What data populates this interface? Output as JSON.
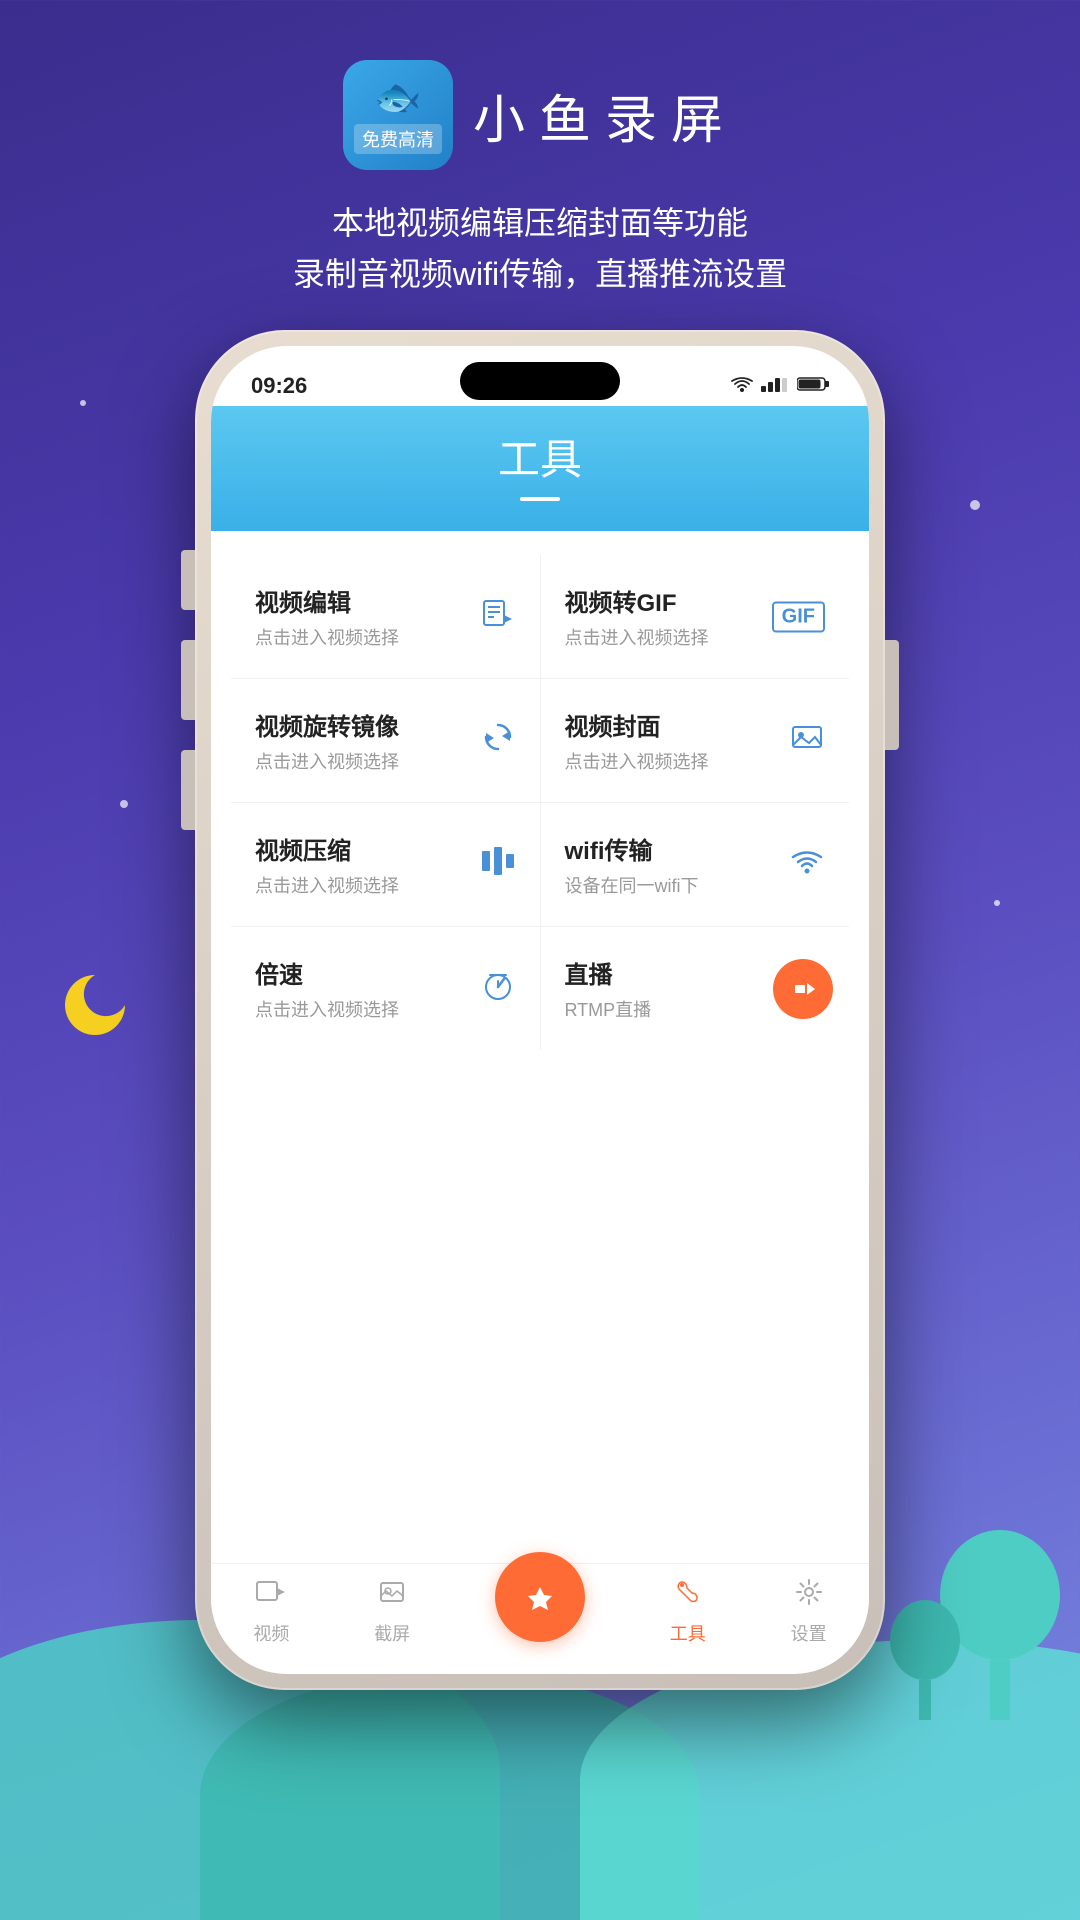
{
  "app": {
    "title": "小鱼录屏",
    "subtitle_line1": "本地视频编辑压缩封面等功能",
    "subtitle_line2": "录制音视频wifi传输，直播推流设置",
    "free_hd": "免费高清",
    "fish_emoji": "🐟"
  },
  "phone": {
    "status_time": "09:26",
    "screen_title": "工具"
  },
  "tools": [
    {
      "name": "视频编辑",
      "desc": "点击进入视频选择",
      "icon_type": "edit",
      "icon": "🎬"
    },
    {
      "name": "视频转GIF",
      "desc": "点击进入视频选择",
      "icon_type": "gif",
      "icon": "GIF"
    },
    {
      "name": "视频旋转镜像",
      "desc": "点击进入视频选择",
      "icon_type": "rotate",
      "icon": "🔄"
    },
    {
      "name": "视频封面",
      "desc": "点击进入视频选择",
      "icon_type": "cover",
      "icon": "🖼"
    },
    {
      "name": "视频压缩",
      "desc": "点击进入视频选择",
      "icon_type": "compress",
      "icon": "🎞"
    },
    {
      "name": "wifi传输",
      "desc": "设备在同一wifi下",
      "icon_type": "wifi",
      "icon": "📶"
    },
    {
      "name": "倍速",
      "desc": "点击进入视频选择",
      "icon_type": "speed",
      "icon": "⏱"
    },
    {
      "name": "直播",
      "desc": "RTMP直播",
      "icon_type": "live",
      "icon": "📹"
    }
  ],
  "nav": {
    "items": [
      {
        "label": "视频",
        "icon": "▶",
        "active": false
      },
      {
        "label": "截屏",
        "icon": "🖼",
        "active": false
      },
      {
        "label": "",
        "icon": "◆",
        "active": false,
        "is_fab": true
      },
      {
        "label": "工具",
        "icon": "🔧",
        "active": true
      },
      {
        "label": "设置",
        "icon": "⚙",
        "active": false
      }
    ]
  }
}
